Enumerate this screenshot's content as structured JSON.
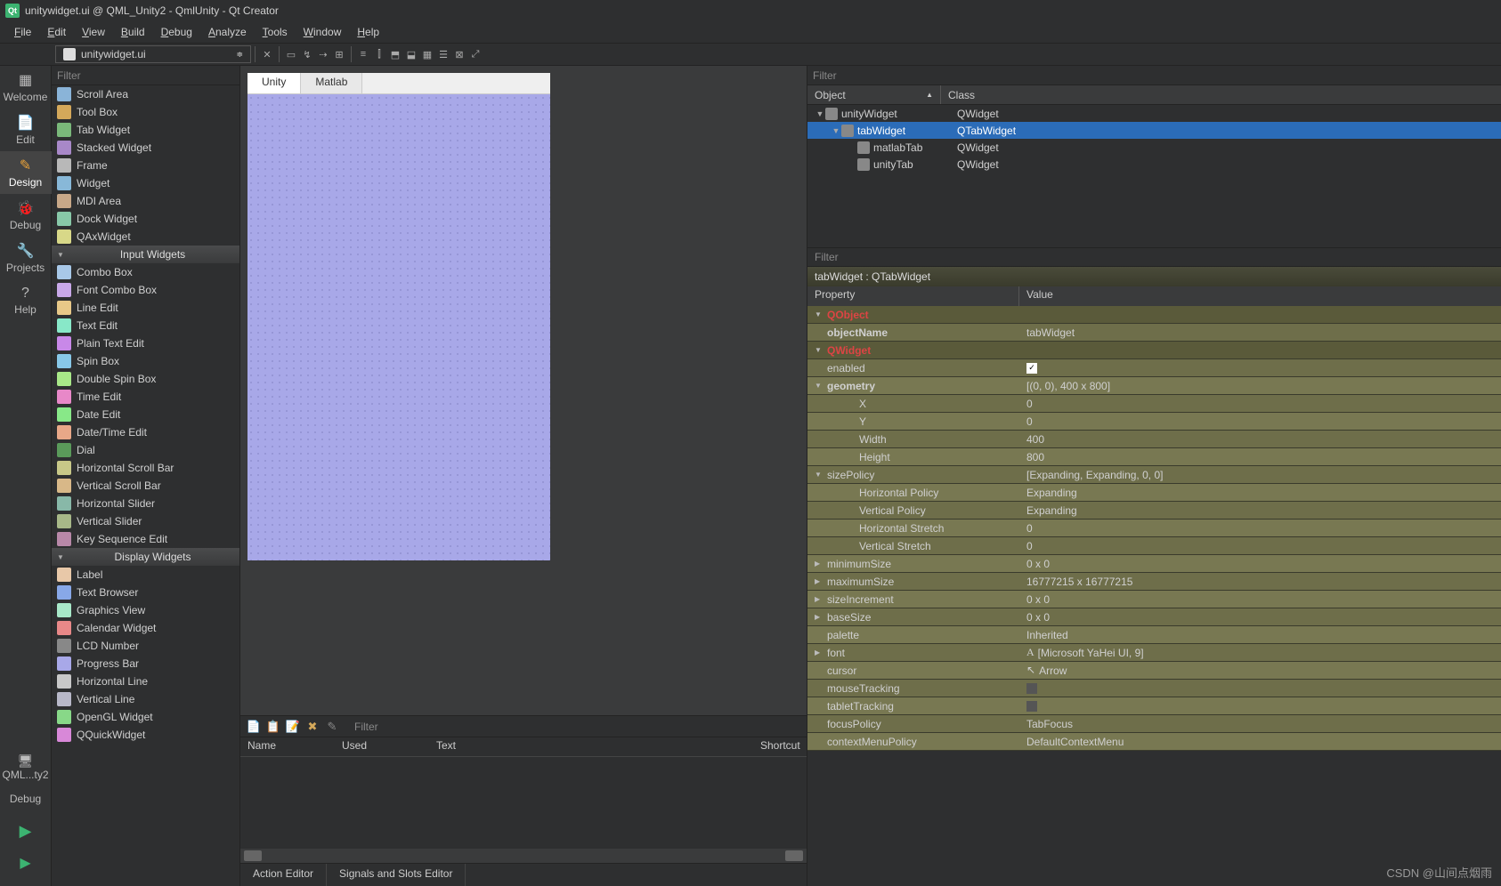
{
  "titlebar": "unitywidget.ui @ QML_Unity2 - QmlUnity - Qt Creator",
  "menubar": [
    "File",
    "Edit",
    "View",
    "Build",
    "Debug",
    "Analyze",
    "Tools",
    "Window",
    "Help"
  ],
  "open_file": "unitywidget.ui",
  "sidebar": {
    "items": [
      {
        "label": "Welcome",
        "icon": "▦"
      },
      {
        "label": "Edit",
        "icon": "📄"
      },
      {
        "label": "Design",
        "icon": "✎"
      },
      {
        "label": "Debug",
        "icon": "🐞"
      },
      {
        "label": "Projects",
        "icon": "🔧"
      },
      {
        "label": "Help",
        "icon": "?"
      }
    ],
    "bottom": {
      "kit": "QML...ty2",
      "mode": "Debug"
    }
  },
  "filter_placeholder": "Filter",
  "widgetbox": [
    {
      "label": "Scroll Area",
      "cls": "ic-scroll"
    },
    {
      "label": "Tool Box",
      "cls": "ic-toolbox"
    },
    {
      "label": "Tab Widget",
      "cls": "ic-tab"
    },
    {
      "label": "Stacked Widget",
      "cls": "ic-stacked"
    },
    {
      "label": "Frame",
      "cls": "ic-frame"
    },
    {
      "label": "Widget",
      "cls": "ic-widget"
    },
    {
      "label": "MDI Area",
      "cls": "ic-mdi"
    },
    {
      "label": "Dock Widget",
      "cls": "ic-dock"
    },
    {
      "label": "QAxWidget",
      "cls": "ic-qax"
    },
    {
      "cat": "Input Widgets"
    },
    {
      "label": "Combo Box",
      "cls": "ic-combo"
    },
    {
      "label": "Font Combo Box",
      "cls": "ic-fcombo"
    },
    {
      "label": "Line Edit",
      "cls": "ic-line"
    },
    {
      "label": "Text Edit",
      "cls": "ic-text"
    },
    {
      "label": "Plain Text Edit",
      "cls": "ic-ptext"
    },
    {
      "label": "Spin Box",
      "cls": "ic-spin"
    },
    {
      "label": "Double Spin Box",
      "cls": "ic-dspin"
    },
    {
      "label": "Time Edit",
      "cls": "ic-time"
    },
    {
      "label": "Date Edit",
      "cls": "ic-date"
    },
    {
      "label": "Date/Time Edit",
      "cls": "ic-dtime"
    },
    {
      "label": "Dial",
      "cls": "ic-dial"
    },
    {
      "label": "Horizontal Scroll Bar",
      "cls": "ic-hscroll"
    },
    {
      "label": "Vertical Scroll Bar",
      "cls": "ic-vscroll"
    },
    {
      "label": "Horizontal Slider",
      "cls": "ic-hslider"
    },
    {
      "label": "Vertical Slider",
      "cls": "ic-vslider"
    },
    {
      "label": "Key Sequence Edit",
      "cls": "ic-keyseq"
    },
    {
      "cat": "Display Widgets"
    },
    {
      "label": "Label",
      "cls": "ic-label"
    },
    {
      "label": "Text Browser",
      "cls": "ic-tbrowser"
    },
    {
      "label": "Graphics View",
      "cls": "ic-gview"
    },
    {
      "label": "Calendar Widget",
      "cls": "ic-cal"
    },
    {
      "label": "LCD Number",
      "cls": "ic-lcd"
    },
    {
      "label": "Progress Bar",
      "cls": "ic-prog"
    },
    {
      "label": "Horizontal Line",
      "cls": "ic-hline"
    },
    {
      "label": "Vertical Line",
      "cls": "ic-vline"
    },
    {
      "label": "OpenGL Widget",
      "cls": "ic-opengl"
    },
    {
      "label": "QQuickWidget",
      "cls": "ic-qquick"
    }
  ],
  "form_tabs": [
    "Unity",
    "Matlab"
  ],
  "signals": {
    "cols": [
      "Name",
      "Used",
      "Text",
      "Shortcut"
    ]
  },
  "bottom_tabs": [
    "Action Editor",
    "Signals and Slots Editor"
  ],
  "object_tree": {
    "headers": [
      "Object",
      "Class"
    ],
    "rows": [
      {
        "indent": 0,
        "name": "unityWidget",
        "class": "QWidget",
        "exp": true
      },
      {
        "indent": 1,
        "name": "tabWidget",
        "class": "QTabWidget",
        "exp": true,
        "selected": true
      },
      {
        "indent": 2,
        "name": "matlabTab",
        "class": "QWidget"
      },
      {
        "indent": 2,
        "name": "unityTab",
        "class": "QWidget"
      }
    ]
  },
  "prop_title": "tabWidget : QTabWidget",
  "prop_headers": [
    "Property",
    "Value"
  ],
  "properties": [
    {
      "cat": "QObject"
    },
    {
      "name": "objectName",
      "val": "tabWidget",
      "bold": true
    },
    {
      "cat": "QWidget"
    },
    {
      "name": "enabled",
      "val": "",
      "check": true
    },
    {
      "name": "geometry",
      "val": "[(0, 0), 400 x 800]",
      "exp": true,
      "bold": true
    },
    {
      "name": "X",
      "val": "0",
      "indent": 1
    },
    {
      "name": "Y",
      "val": "0",
      "indent": 1
    },
    {
      "name": "Width",
      "val": "400",
      "indent": 1
    },
    {
      "name": "Height",
      "val": "800",
      "indent": 1
    },
    {
      "name": "sizePolicy",
      "val": "[Expanding, Expanding, 0, 0]",
      "exp": true
    },
    {
      "name": "Horizontal Policy",
      "val": "Expanding",
      "indent": 1
    },
    {
      "name": "Vertical Policy",
      "val": "Expanding",
      "indent": 1
    },
    {
      "name": "Horizontal Stretch",
      "val": "0",
      "indent": 1
    },
    {
      "name": "Vertical Stretch",
      "val": "0",
      "indent": 1
    },
    {
      "name": "minimumSize",
      "val": "0 x 0",
      "col": true
    },
    {
      "name": "maximumSize",
      "val": "16777215 x 16777215",
      "col": true
    },
    {
      "name": "sizeIncrement",
      "val": "0 x 0",
      "col": true
    },
    {
      "name": "baseSize",
      "val": "0 x 0",
      "col": true
    },
    {
      "name": "palette",
      "val": "Inherited"
    },
    {
      "name": "font",
      "val": "[Microsoft YaHei UI, 9]",
      "col": true,
      "icon": "A"
    },
    {
      "name": "cursor",
      "val": "Arrow",
      "icon": "↖"
    },
    {
      "name": "mouseTracking",
      "val": "",
      "checkEmpty": true
    },
    {
      "name": "tabletTracking",
      "val": "",
      "checkEmpty": true
    },
    {
      "name": "focusPolicy",
      "val": "TabFocus"
    },
    {
      "name": "contextMenuPolicy",
      "val": "DefaultContextMenu"
    }
  ],
  "watermark": "CSDN @山间点烟雨"
}
